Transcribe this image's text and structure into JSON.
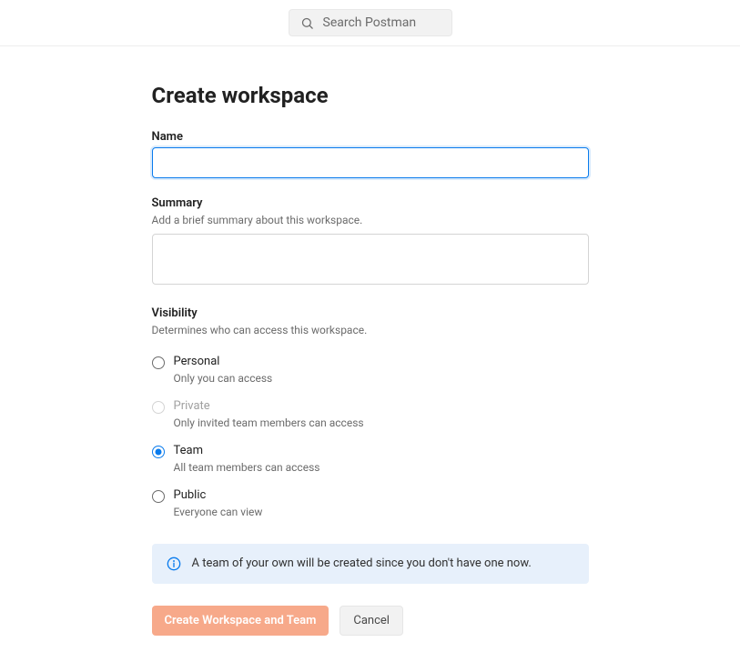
{
  "header": {
    "search_placeholder": "Search Postman"
  },
  "page": {
    "title": "Create workspace"
  },
  "fields": {
    "name": {
      "label": "Name",
      "value": ""
    },
    "summary": {
      "label": "Summary",
      "helper": "Add a brief summary about this workspace.",
      "value": ""
    },
    "visibility": {
      "label": "Visibility",
      "helper": "Determines who can access this workspace.",
      "options": [
        {
          "title": "Personal",
          "desc": "Only you can access",
          "selected": false,
          "disabled": false
        },
        {
          "title": "Private",
          "desc": "Only invited team members can access",
          "selected": false,
          "disabled": true
        },
        {
          "title": "Team",
          "desc": "All team members can access",
          "selected": true,
          "disabled": false
        },
        {
          "title": "Public",
          "desc": "Everyone can view",
          "selected": false,
          "disabled": false
        }
      ]
    }
  },
  "banner": {
    "text": "A team of your own will be created since you don't have one now."
  },
  "buttons": {
    "primary": "Create Workspace and Team",
    "cancel": "Cancel"
  }
}
